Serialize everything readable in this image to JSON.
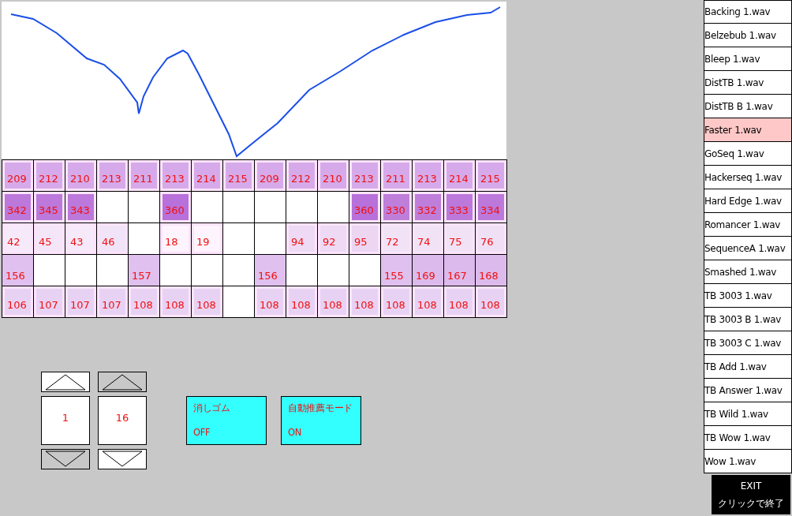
{
  "grid": {
    "rows": [
      {
        "kind": "inset",
        "cells": [
          {
            "value": "209",
            "color": "#d6aaea"
          },
          {
            "value": "212",
            "color": "#d6aaea"
          },
          {
            "value": "210",
            "color": "#d6aaea"
          },
          {
            "value": "213",
            "color": "#d6aaea"
          },
          {
            "value": "211",
            "color": "#d6aaea"
          },
          {
            "value": "213",
            "color": "#d6aaea"
          },
          {
            "value": "214",
            "color": "#d6aaea"
          },
          {
            "value": "215",
            "color": "#d6aaea"
          },
          {
            "value": "209",
            "color": "#d6aaea"
          },
          {
            "value": "212",
            "color": "#d6aaea"
          },
          {
            "value": "210",
            "color": "#d6aaea"
          },
          {
            "value": "213",
            "color": "#d6aaea"
          },
          {
            "value": "211",
            "color": "#d6aaea"
          },
          {
            "value": "213",
            "color": "#d6aaea"
          },
          {
            "value": "214",
            "color": "#d6aaea"
          },
          {
            "value": "215",
            "color": "#d6aaea"
          }
        ]
      },
      {
        "kind": "inset",
        "cells": [
          {
            "value": "342",
            "color": "#bc78da"
          },
          {
            "value": "345",
            "color": "#bc78da"
          },
          {
            "value": "343",
            "color": "#bc78da"
          },
          null,
          null,
          {
            "value": "360",
            "color": "#b870da"
          },
          null,
          null,
          null,
          null,
          null,
          {
            "value": "360",
            "color": "#b870da"
          },
          {
            "value": "330",
            "color": "#bf7eda"
          },
          {
            "value": "332",
            "color": "#bf7eda"
          },
          {
            "value": "333",
            "color": "#bc78da"
          },
          {
            "value": "334",
            "color": "#bc78da"
          }
        ]
      },
      {
        "kind": "inset",
        "cells": [
          {
            "value": "42",
            "color": "#f6eafa"
          },
          {
            "value": "45",
            "color": "#f4e6f8"
          },
          {
            "value": "43",
            "color": "#f6eafa"
          },
          {
            "value": "46",
            "color": "#f2e4f8"
          },
          null,
          {
            "value": "18",
            "color": "#fdf4fd"
          },
          {
            "value": "19",
            "color": "#fdf4fd"
          },
          null,
          null,
          {
            "value": "94",
            "color": "#eedaf4"
          },
          {
            "value": "92",
            "color": "#eedaf4"
          },
          {
            "value": "95",
            "color": "#ecd6f2"
          },
          {
            "value": "72",
            "color": "#f2e2f6"
          },
          {
            "value": "74",
            "color": "#f2e2f6"
          },
          {
            "value": "75",
            "color": "#f2e2f6"
          },
          {
            "value": "76",
            "color": "#f0e0f6"
          }
        ]
      },
      {
        "kind": "full",
        "cells": [
          {
            "value": "156",
            "color": "#e0c0ee"
          },
          null,
          null,
          null,
          {
            "value": "157",
            "color": "#e0c0ee"
          },
          null,
          null,
          null,
          {
            "value": "156",
            "color": "#e0c0ee"
          },
          null,
          null,
          null,
          {
            "value": "155",
            "color": "#e0c0ee"
          },
          {
            "value": "169",
            "color": "#dcbaec"
          },
          {
            "value": "167",
            "color": "#dcbaec"
          },
          {
            "value": "168",
            "color": "#dcbaec"
          }
        ]
      },
      {
        "kind": "inset",
        "cells": [
          {
            "value": "106",
            "color": "#e8d2f4"
          },
          {
            "value": "107",
            "color": "#e8d2f4"
          },
          {
            "value": "107",
            "color": "#e8d2f4"
          },
          {
            "value": "107",
            "color": "#e8d2f4"
          },
          {
            "value": "108",
            "color": "#e8d2f4"
          },
          {
            "value": "108",
            "color": "#e8d2f4"
          },
          {
            "value": "108",
            "color": "#e8d2f4"
          },
          null,
          {
            "value": "108",
            "color": "#e8d2f4"
          },
          {
            "value": "108",
            "color": "#e8d2f4"
          },
          {
            "value": "108",
            "color": "#e8d2f4"
          },
          {
            "value": "108",
            "color": "#e8d2f4"
          },
          {
            "value": "108",
            "color": "#e8d2f4"
          },
          {
            "value": "108",
            "color": "#e8d2f4"
          },
          {
            "value": "108",
            "color": "#e8d2f4"
          },
          {
            "value": "108",
            "color": "#e8d2f4"
          }
        ]
      }
    ]
  },
  "steppers": [
    {
      "value": "1",
      "up_disabled": false,
      "down_disabled": true
    },
    {
      "value": "16",
      "up_disabled": true,
      "down_disabled": false
    }
  ],
  "toggles": [
    {
      "label": "消しゴム",
      "state": "OFF"
    },
    {
      "label": "自動推薦モード",
      "state": "ON"
    }
  ],
  "file_list": [
    {
      "name": "Backing 1.wav",
      "selected": false
    },
    {
      "name": "Belzebub 1.wav",
      "selected": false
    },
    {
      "name": "Bleep 1.wav",
      "selected": false
    },
    {
      "name": "DistTB 1.wav",
      "selected": false
    },
    {
      "name": "DistTB B 1.wav",
      "selected": false
    },
    {
      "name": "Faster 1.wav",
      "selected": true
    },
    {
      "name": "GoSeq 1.wav",
      "selected": false
    },
    {
      "name": "Hackerseq 1.wav",
      "selected": false
    },
    {
      "name": "Hard Edge 1.wav",
      "selected": false
    },
    {
      "name": "Romancer 1.wav",
      "selected": false
    },
    {
      "name": "SequenceA 1.wav",
      "selected": false
    },
    {
      "name": "Smashed 1.wav",
      "selected": false
    },
    {
      "name": "TB 3003 1.wav",
      "selected": false
    },
    {
      "name": "TB 3003 B 1.wav",
      "selected": false
    },
    {
      "name": "TB 3003 C 1.wav",
      "selected": false
    },
    {
      "name": "TB Add 1.wav",
      "selected": false
    },
    {
      "name": "TB Answer 1.wav",
      "selected": false
    },
    {
      "name": "TB Wild 1.wav",
      "selected": false
    },
    {
      "name": "TB Wow 1.wav",
      "selected": false
    },
    {
      "name": "Wow 1.wav",
      "selected": false
    }
  ],
  "exit_button": {
    "label": "EXIT",
    "caption": "クリックで終了"
  }
}
